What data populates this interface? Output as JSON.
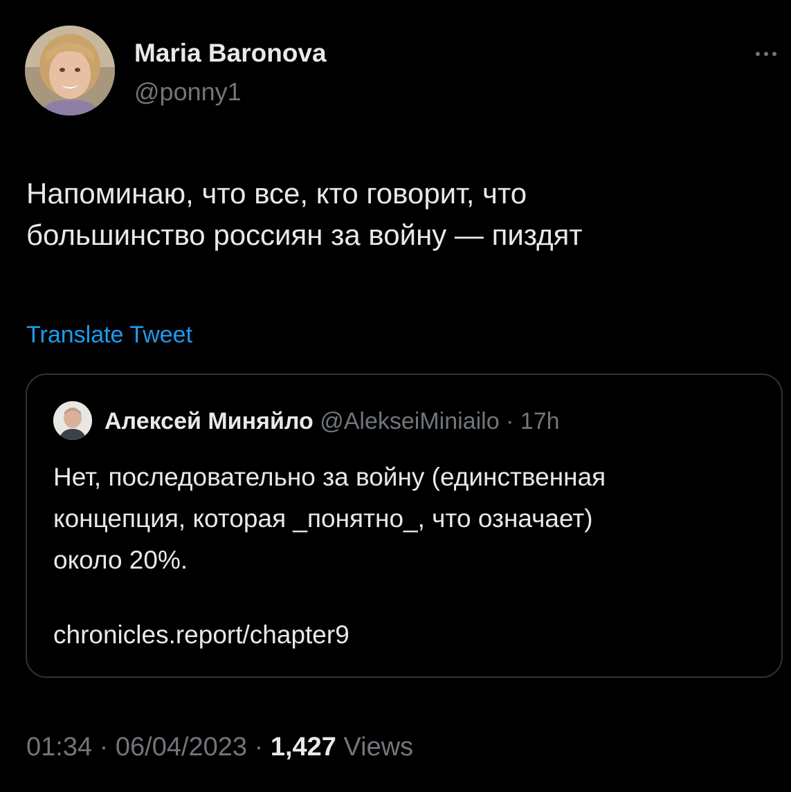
{
  "tweet": {
    "author": {
      "name": "Maria Baronova",
      "handle": "@ponny1"
    },
    "text": "Напоминаю, что все, кто говорит, что\nбольшинство россиян за войну — пиздят",
    "translate_label": "Translate Tweet",
    "quoted": {
      "author_name": "Алексей Миняйло",
      "author_handle": "@AlekseiMiniailo",
      "separator": "·",
      "time": "17h",
      "text": "Нет, последовательно за войну (единственная\nконцепция, которая _понятно_, что означает)\nоколо 20%.",
      "link": "chronicles.report/chapter9"
    },
    "time": "01:34",
    "date": "06/04/2023",
    "separator": "·",
    "views_count": "1,427",
    "views_label": "Views"
  },
  "icons": {
    "more": "more-horizontal-icon"
  },
  "colors": {
    "background": "#000000",
    "text_primary": "#e7e9ea",
    "text_secondary": "#71767b",
    "accent": "#1d9bf0",
    "border": "#2f3336"
  }
}
